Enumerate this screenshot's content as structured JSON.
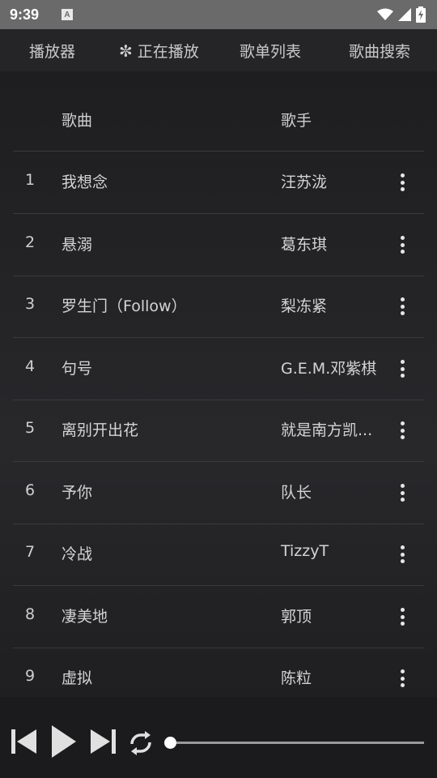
{
  "status_bar": {
    "time": "9:39",
    "notification_icon_letter": "A",
    "icons": [
      "wifi-icon",
      "signal-icon",
      "battery-charging-icon"
    ]
  },
  "nav": {
    "tabs": [
      {
        "label": "播放器",
        "active": false
      },
      {
        "label": "正在播放",
        "active": true,
        "icon": "flower-icon",
        "icon_glyph": "✼"
      },
      {
        "label": "歌单列表",
        "active": false
      },
      {
        "label": "歌曲搜索",
        "active": false
      }
    ]
  },
  "table": {
    "headers": {
      "song": "歌曲",
      "artist": "歌手"
    },
    "rows": [
      {
        "index": "1",
        "title": "我想念",
        "artist": "汪苏泷"
      },
      {
        "index": "2",
        "title": "悬溺",
        "artist": "葛东琪"
      },
      {
        "index": "3",
        "title": "罗生门（Follow）",
        "artist": "梨冻紧"
      },
      {
        "index": "4",
        "title": "句号",
        "artist": "G.E.M.邓紫棋"
      },
      {
        "index": "5",
        "title": "离别开出花",
        "artist": "就是南方凯..."
      },
      {
        "index": "6",
        "title": "予你",
        "artist": "队长"
      },
      {
        "index": "7",
        "title": "冷战",
        "artist": "TizzyT"
      },
      {
        "index": "8",
        "title": "凄美地",
        "artist": "郭顶"
      },
      {
        "index": "9",
        "title": "虚拟",
        "artist": "陈粒"
      }
    ]
  },
  "player": {
    "controls": [
      "skip-previous-icon",
      "play-icon",
      "skip-next-icon",
      "repeat-icon"
    ],
    "progress": 0.0
  },
  "colors": {
    "status_bar_bg": "#6a6a6a",
    "nav_bg": "#252528",
    "content_bg": "#1e1e20",
    "divider": "#3a3a3d",
    "text": "#d4d4d4"
  }
}
